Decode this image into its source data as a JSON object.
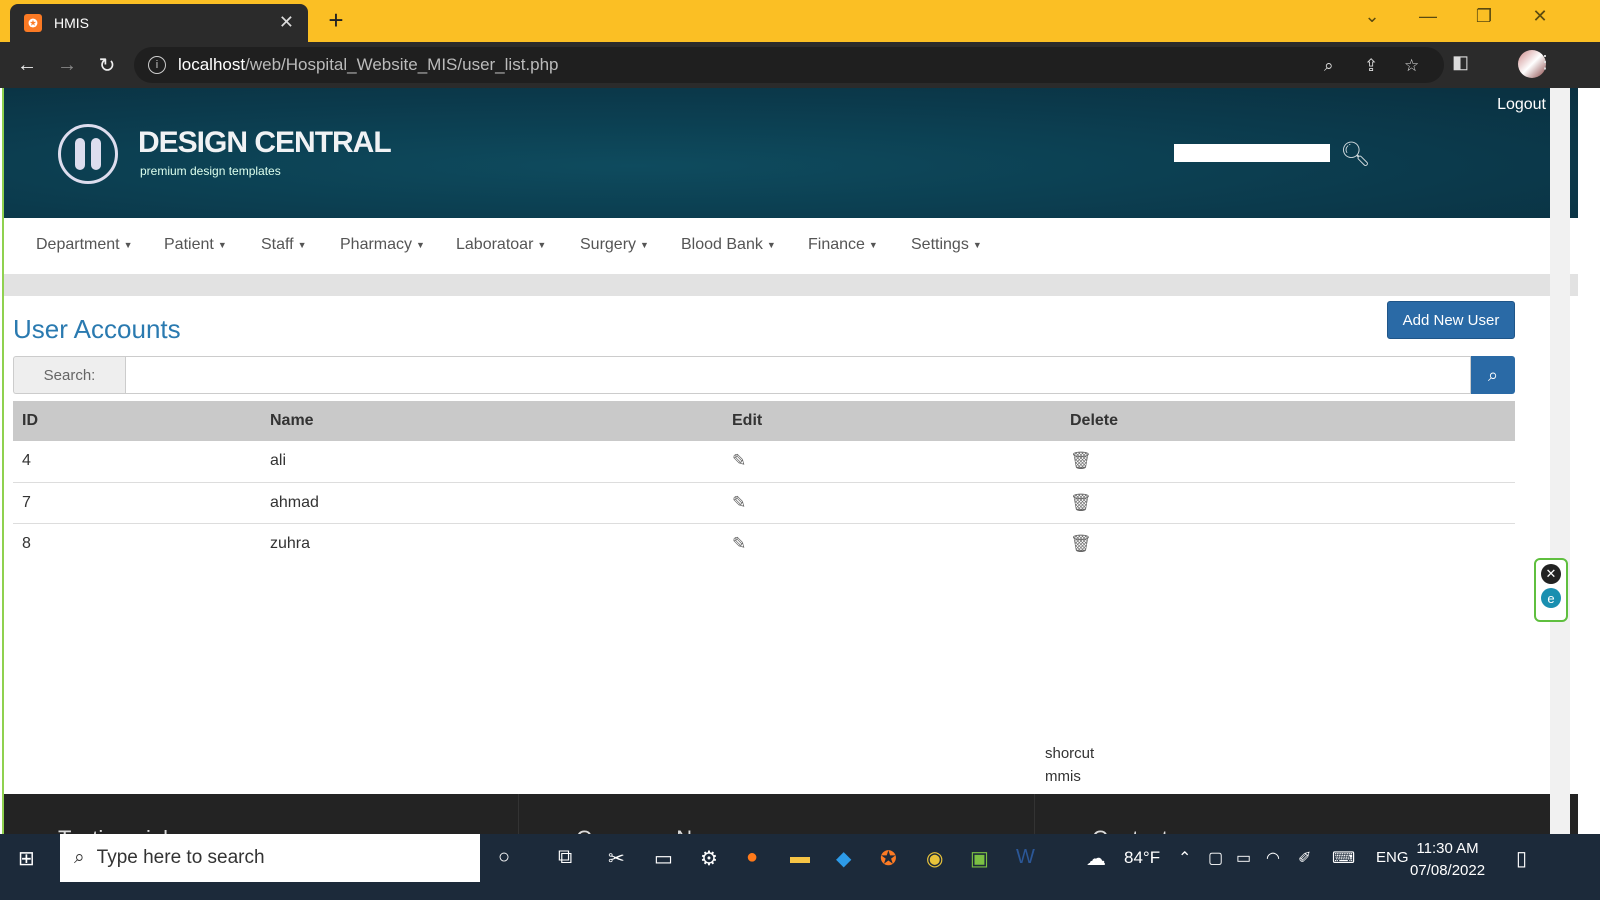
{
  "browser": {
    "tab_title": "HMIS",
    "tab_favicon": "xampp-icon",
    "url_host": "localhost",
    "url_path": "/web/Hospital_Website_MIS/user_list.php"
  },
  "header": {
    "logout": "Logout",
    "brand": "DESIGN CENTRAL",
    "tagline": "premium design templates"
  },
  "nav": {
    "items": [
      {
        "label": "Department"
      },
      {
        "label": "Patient"
      },
      {
        "label": "Staff"
      },
      {
        "label": "Pharmacy"
      },
      {
        "label": "Laboratoar"
      },
      {
        "label": "Surgery"
      },
      {
        "label": "Blood Bank"
      },
      {
        "label": "Finance"
      },
      {
        "label": "Settings"
      }
    ]
  },
  "main": {
    "title": "User Accounts",
    "add_button": "Add New User",
    "search_label": "Search:",
    "table": {
      "headers": [
        "ID",
        "Name",
        "Edit",
        "Delete"
      ],
      "rows": [
        {
          "id": "4",
          "name": "ali"
        },
        {
          "id": "7",
          "name": "ahmad"
        },
        {
          "id": "8",
          "name": "zuhra"
        }
      ]
    },
    "shortcut_line1": "shorcut",
    "shortcut_line2": "mmis"
  },
  "footer": {
    "col1": "Testimonials",
    "col2": "Company News",
    "col3": "Contact"
  },
  "taskbar": {
    "search_placeholder": "Type here to search",
    "weather": "84°F",
    "language": "ENG",
    "time": "11:30 AM",
    "date": "07/08/2022"
  },
  "colors": {
    "chrome_frame": "#fbbf24",
    "header_bg": "#0b3a4c",
    "accent_blue": "#2a6aa6",
    "title_blue": "#2a7ab0"
  }
}
